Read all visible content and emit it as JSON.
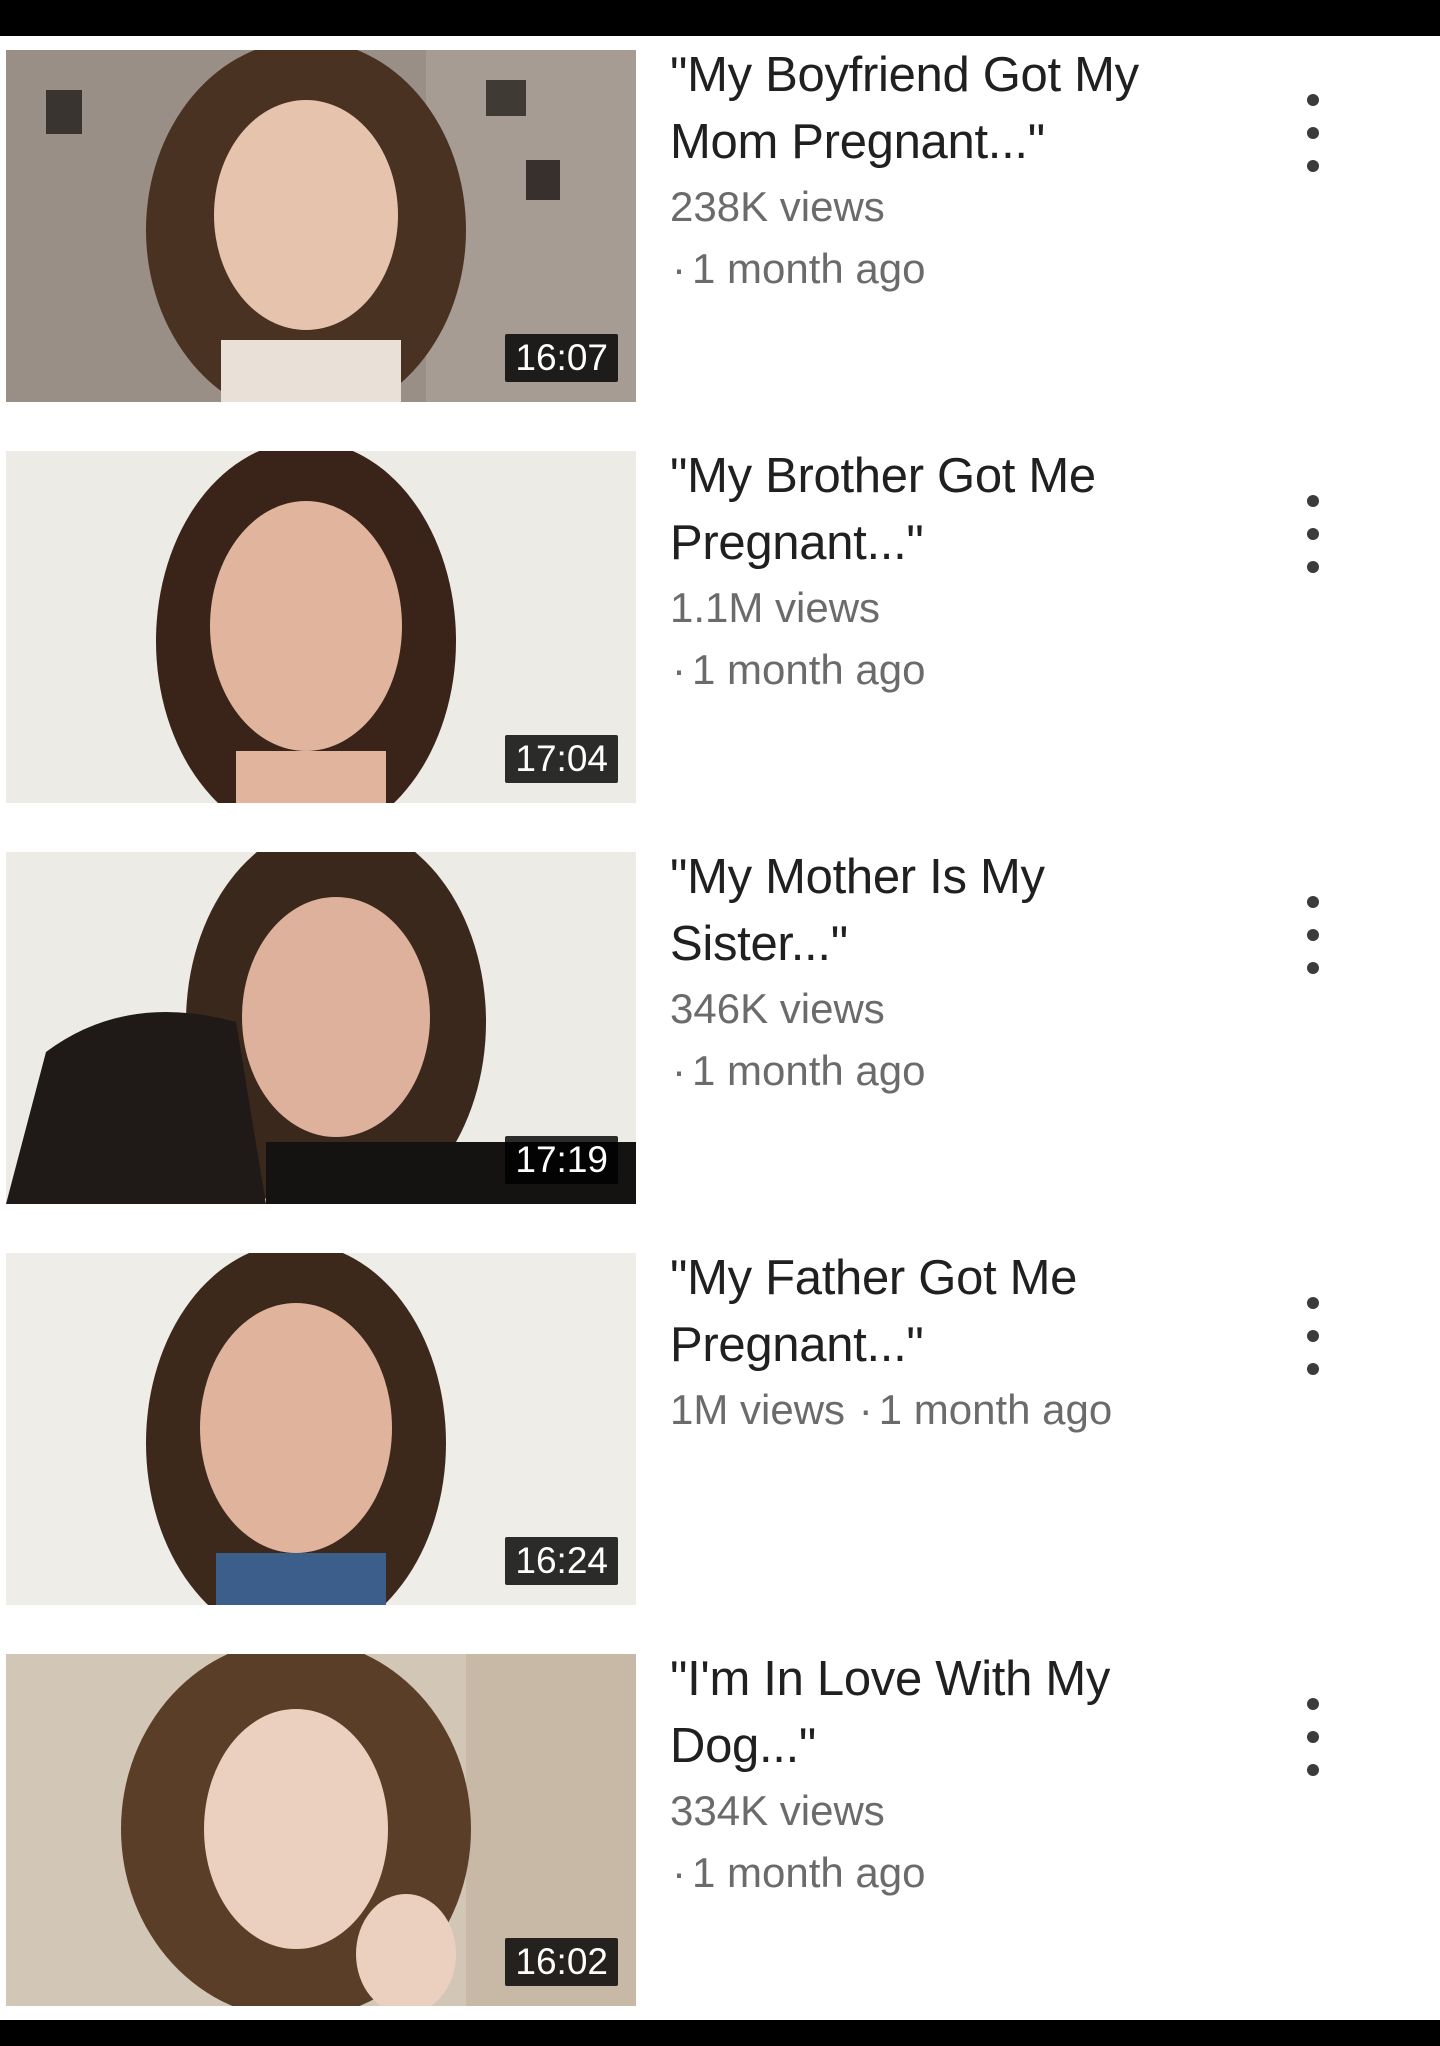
{
  "videos": [
    {
      "title": "\"My Boyfriend Got My Mom Pregnant...\"",
      "views": "238K views",
      "age": "1 month ago",
      "duration": "16:07",
      "meta_inline": false
    },
    {
      "title": "\"My Brother Got Me Pregnant...\"",
      "views": "1.1M views",
      "age": "1 month ago",
      "duration": "17:04",
      "meta_inline": false
    },
    {
      "title": "\"My Mother Is My Sister...\"",
      "views": "346K views",
      "age": "1 month ago",
      "duration": "17:19",
      "meta_inline": false
    },
    {
      "title": "\"My Father Got Me Pregnant...\"",
      "views": "1M views",
      "age": "1 month ago",
      "duration": "16:24",
      "meta_inline": true
    },
    {
      "title": "\"I'm In Love With My Dog...\"",
      "views": "334K views",
      "age": "1 month ago",
      "duration": "16:02",
      "meta_inline": false
    }
  ],
  "separator": "·",
  "icons": {
    "more": "more-vert-icon"
  },
  "colors": {
    "title": "#202020",
    "meta": "#6b6b6b",
    "duration_bg": "#000000"
  }
}
